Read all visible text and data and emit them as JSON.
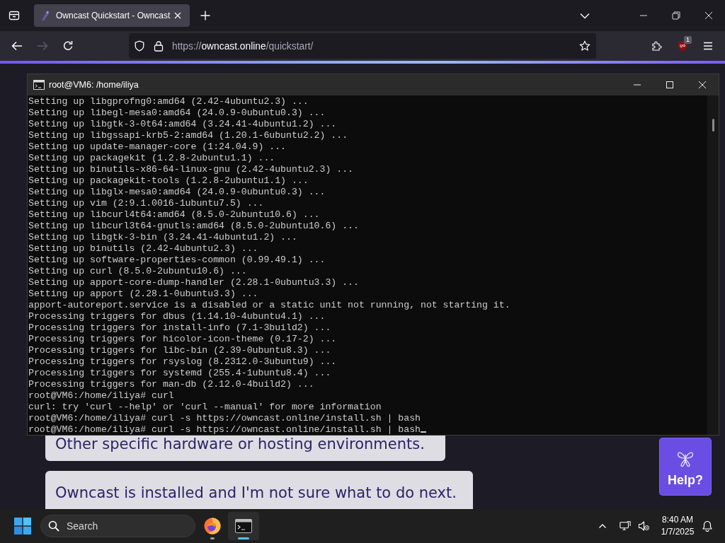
{
  "browser": {
    "tabs": [
      {
        "title": "Owncast Quickstart - Owncast",
        "selected": true
      }
    ],
    "navigation": {
      "back_enabled": true,
      "forward_enabled": false
    },
    "url": {
      "scheme": "https://",
      "host": "owncast.online",
      "path": "/quickstart/"
    },
    "extension_badge": "1"
  },
  "terminal": {
    "title": "root@VM6: /home/iliya",
    "lines": [
      "Setting up libgprofng0:amd64 (2.42-4ubuntu2.3) ...",
      "Setting up libegl-mesa0:amd64 (24.0.9-0ubuntu0.3) ...",
      "Setting up libgtk-3-0t64:amd64 (3.24.41-4ubuntu1.2) ...",
      "Setting up libgssapi-krb5-2:amd64 (1.20.1-6ubuntu2.2) ...",
      "Setting up update-manager-core (1:24.04.9) ...",
      "Setting up packagekit (1.2.8-2ubuntu1.1) ...",
      "Setting up binutils-x86-64-linux-gnu (2.42-4ubuntu2.3) ...",
      "Setting up packagekit-tools (1.2.8-2ubuntu1.1) ...",
      "Setting up libglx-mesa0:amd64 (24.0.9-0ubuntu0.3) ...",
      "Setting up vim (2:9.1.0016-1ubuntu7.5) ...",
      "Setting up libcurl4t64:amd64 (8.5.0-2ubuntu10.6) ...",
      "Setting up libcurl3t64-gnutls:amd64 (8.5.0-2ubuntu10.6) ...",
      "Setting up libgtk-3-bin (3.24.41-4ubuntu1.2) ...",
      "Setting up binutils (2.42-4ubuntu2.3) ...",
      "Setting up software-properties-common (0.99.49.1) ...",
      "Setting up curl (8.5.0-2ubuntu10.6) ...",
      "Setting up apport-core-dump-handler (2.28.1-0ubuntu3.3) ...",
      "Setting up apport (2.28.1-0ubuntu3.3) ...",
      "apport-autoreport.service is a disabled or a static unit not running, not starting it.",
      "Processing triggers for dbus (1.14.10-4ubuntu4.1) ...",
      "Processing triggers for install-info (7.1-3build2) ...",
      "Processing triggers for hicolor-icon-theme (0.17-2) ...",
      "Processing triggers for libc-bin (2.39-0ubuntu8.3) ...",
      "Processing triggers for rsyslog (8.2312.0-3ubuntu9) ...",
      "Processing triggers for systemd (255.4-1ubuntu8.4) ...",
      "Processing triggers for man-db (2.12.0-4build2) ...",
      "root@VM6:/home/iliya# curl",
      "curl: try 'curl --help' or 'curl --manual' for more information",
      "root@VM6:/home/iliya# curl -s https://owncast.online/install.sh | bash",
      "root@VM6:/home/iliya# curl -s https://owncast.online/install.sh | bash"
    ],
    "cursor": true
  },
  "page": {
    "choices": [
      {
        "label": "Other specific hardware or hosting environments."
      },
      {
        "label": "Owncast is installed and I'm not sure what to do next."
      }
    ],
    "help_button": "Help?"
  },
  "taskbar": {
    "search": {
      "placeholder": "Search"
    },
    "apps": [
      {
        "kind": "browser",
        "running": true,
        "selected": false
      },
      {
        "kind": "terminal",
        "running": true,
        "selected": true
      }
    ],
    "time": "8:40 AM",
    "date": "1/7/2025"
  }
}
